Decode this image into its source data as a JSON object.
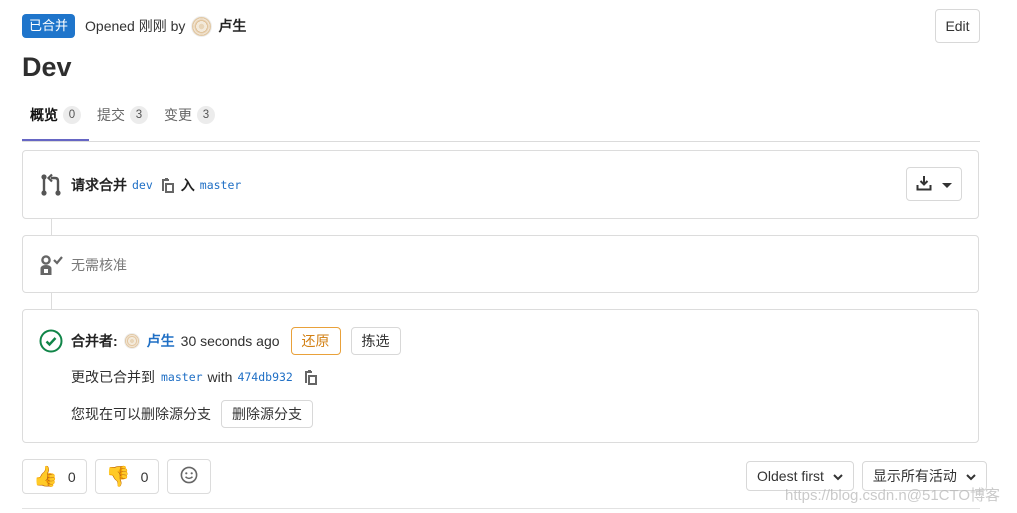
{
  "header": {
    "status_badge": "已合并",
    "opened_prefix": "Opened",
    "opened_time": "刚刚",
    "by_label": "by",
    "author": "卢生",
    "edit_label": "Edit"
  },
  "title": "Dev",
  "tabs": [
    {
      "label": "概览",
      "count": "0",
      "active": true
    },
    {
      "label": "提交",
      "count": "3",
      "active": false
    },
    {
      "label": "变更",
      "count": "3",
      "active": false
    }
  ],
  "merge_request": {
    "label": "请求合并",
    "source_branch": "dev",
    "into_label": "入",
    "target_branch": "master",
    "icon": "merge-request-icon"
  },
  "approval": {
    "text": "无需核准",
    "icon": "approval-icon"
  },
  "merged": {
    "label": "合并者:",
    "user": "卢生",
    "time": "30 seconds ago",
    "revert_label": "还原",
    "cherry_pick_label": "拣选",
    "merged_into_prefix": "更改已合并到",
    "target_branch": "master",
    "with_label": "with",
    "commit_sha": "474db932",
    "delete_hint": "您现在可以删除源分支",
    "delete_branch_label": "删除源分支"
  },
  "reactions": {
    "thumbs_up_count": "0",
    "thumbs_down_count": "0"
  },
  "activity": {
    "sort_label": "Oldest first",
    "filter_label": "显示所有活动"
  },
  "watermark": "https://blog.csdn.n@51CTO博客",
  "colors": {
    "merged_badge": "#1f75cb",
    "link": "#1f6fc5",
    "active_tab": "#6666c4",
    "success": "#108548",
    "revert": "#d27f12"
  }
}
